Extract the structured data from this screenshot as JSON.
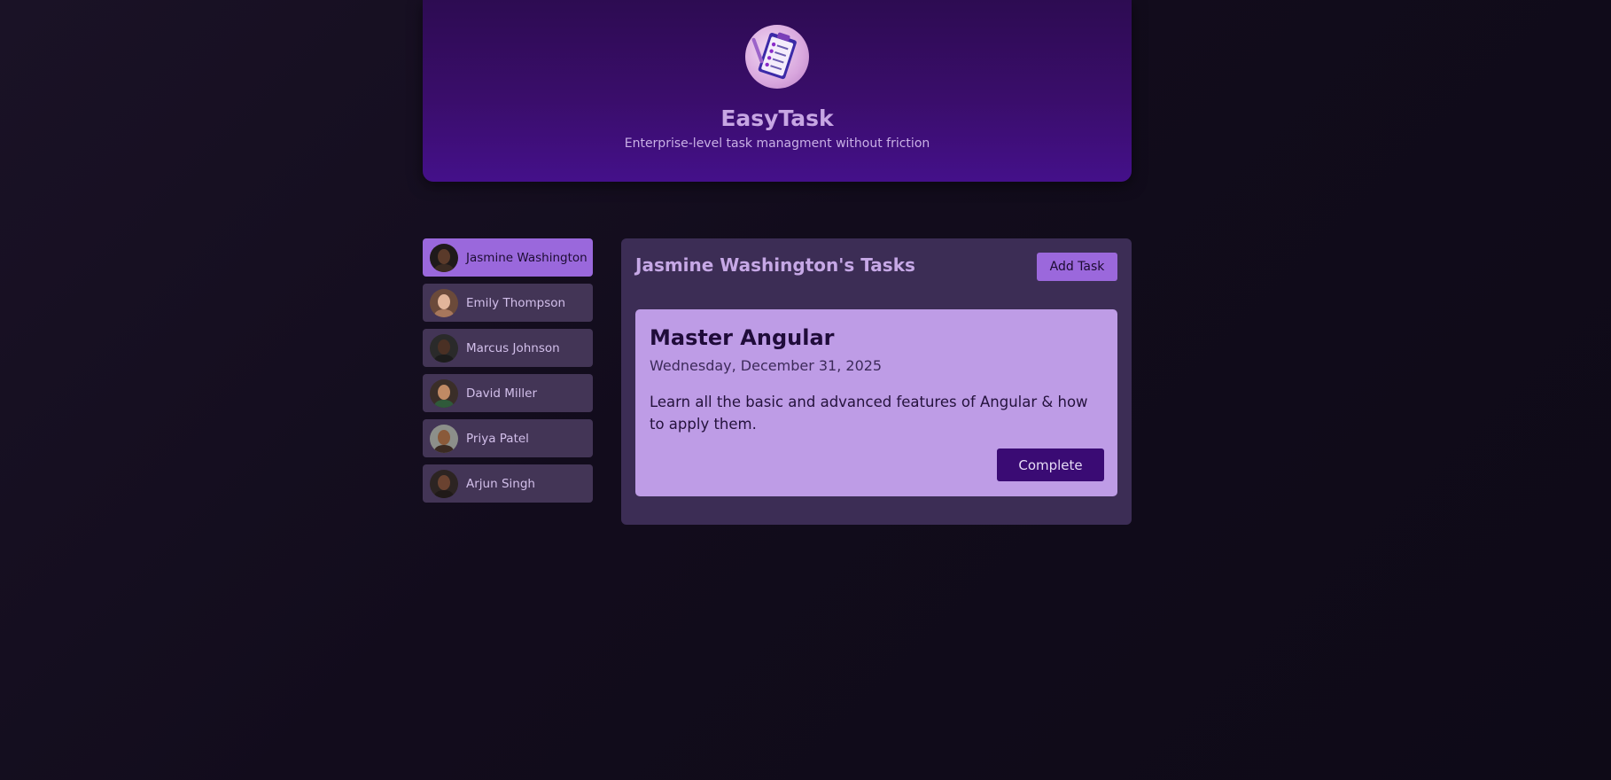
{
  "header": {
    "logo_icon": "clipboard-checklist-icon",
    "title": "EasyTask",
    "subtitle": "Enterprise-level task managment without friction"
  },
  "users": [
    {
      "name": "Jasmine Washington",
      "selected": true,
      "avatar_skin": "#5a3a2a",
      "avatar_bg": "#1f1a1a"
    },
    {
      "name": "Emily Thompson",
      "selected": false,
      "avatar_skin": "#e2b59a",
      "avatar_bg": "#6b4a3a"
    },
    {
      "name": "Marcus Johnson",
      "selected": false,
      "avatar_skin": "#4a3024",
      "avatar_bg": "#2a2a2a"
    },
    {
      "name": "David Miller",
      "selected": false,
      "avatar_skin": "#c08a64",
      "avatar_bg": "#3a2e28"
    },
    {
      "name": "Priya Patel",
      "selected": false,
      "avatar_skin": "#8a5a3a",
      "avatar_bg": "#8c8f8a"
    },
    {
      "name": "Arjun Singh",
      "selected": false,
      "avatar_skin": "#6a4230",
      "avatar_bg": "#2c2422"
    }
  ],
  "tasks_panel": {
    "title": "Jasmine Washington's Tasks",
    "add_task_label": "Add Task"
  },
  "task": {
    "title": "Master Angular",
    "due_date": "Wednesday, December 31, 2025",
    "summary": "Learn all the basic and advanced features of Angular & how to apply them.",
    "complete_label": "Complete"
  },
  "colors": {
    "background": "#120c1c",
    "header": "#3a0d6b",
    "accent": "#9a68dc",
    "panel": "#3c2d55",
    "card": "#be9ce6",
    "button_dark": "#3a0b74"
  }
}
